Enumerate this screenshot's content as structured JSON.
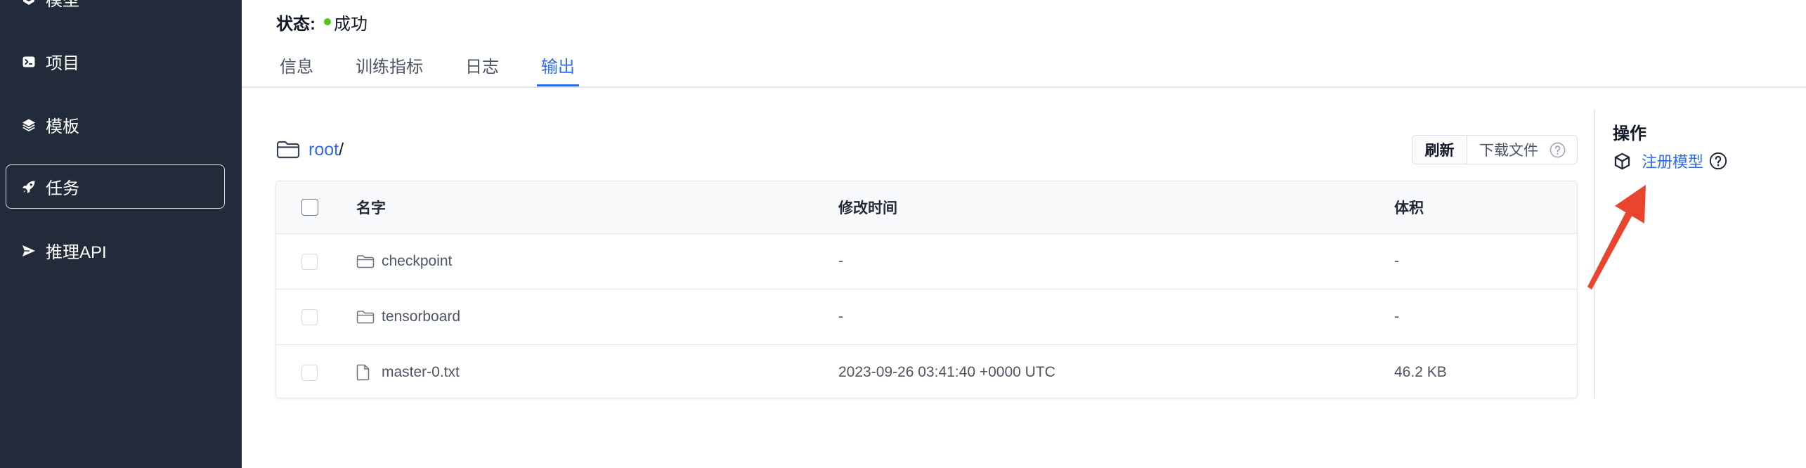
{
  "sidebar": {
    "items": [
      {
        "label": "模型",
        "icon": "model-icon"
      },
      {
        "label": "项目",
        "icon": "terminal-icon"
      },
      {
        "label": "模板",
        "icon": "layers-icon"
      },
      {
        "label": "任务",
        "icon": "rocket-icon",
        "active": true
      },
      {
        "label": "推理API",
        "icon": "send-icon"
      }
    ]
  },
  "status": {
    "label": "状态:",
    "value": "成功",
    "indicator_color": "#52c41a"
  },
  "tabs": [
    {
      "label": "信息"
    },
    {
      "label": "训练指标"
    },
    {
      "label": "日志"
    },
    {
      "label": "输出",
      "active": true
    }
  ],
  "breadcrumb": {
    "icon": "folder-open-icon",
    "root": "root",
    "separator": "/"
  },
  "toolbar": {
    "refresh_label": "刷新",
    "download_label": "下载文件",
    "download_help_icon": "question-circle-icon"
  },
  "table": {
    "columns": [
      "名字",
      "修改时间",
      "体积"
    ],
    "rows": [
      {
        "icon": "folder-icon",
        "name": "checkpoint",
        "modified": "-",
        "size": "-"
      },
      {
        "icon": "folder-icon",
        "name": "tensorboard",
        "modified": "-",
        "size": "-"
      },
      {
        "icon": "file-icon",
        "name": "master-0.txt",
        "modified": "2023-09-26 03:41:40 +0000 UTC",
        "size": "46.2 KB"
      }
    ]
  },
  "actions": {
    "title": "操作",
    "register_model_label": "注册模型",
    "register_icon": "cube-icon",
    "help_icon": "question-circle-icon"
  },
  "colors": {
    "sidebar_bg": "#222b3a",
    "accent": "#2f6bea",
    "status_success": "#52c41a",
    "annotation_arrow": "#e9442e"
  }
}
